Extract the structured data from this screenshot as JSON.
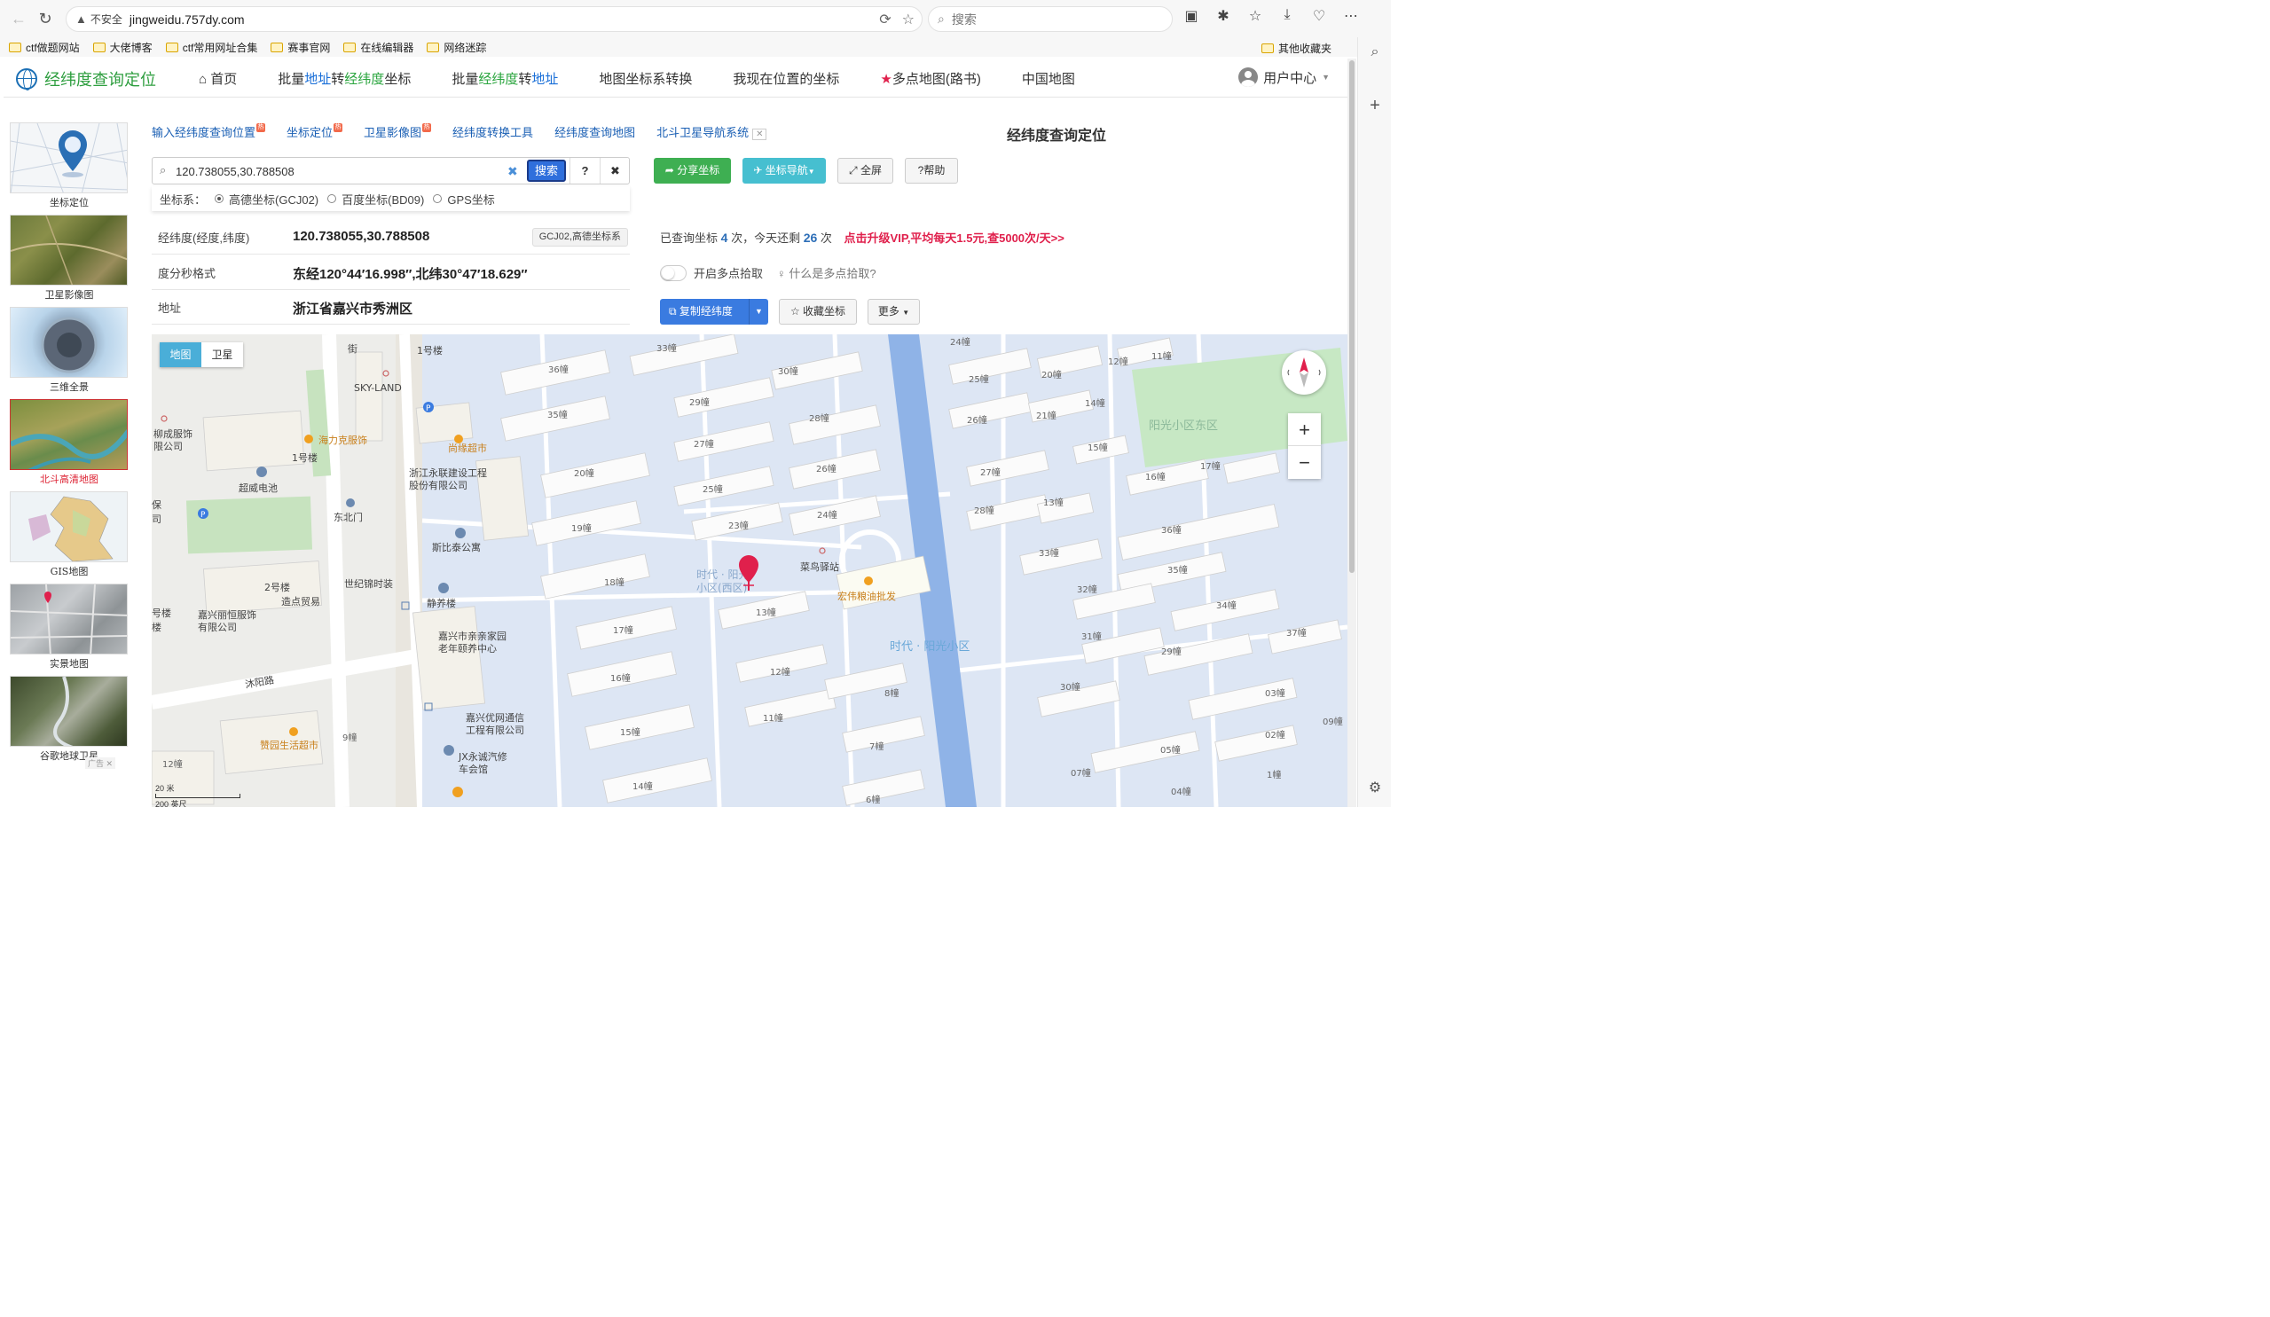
{
  "browser": {
    "insecure_label": "不安全",
    "url": "jingweidu.757dy.com",
    "search_placeholder": "搜索",
    "bookmarks": [
      "ctf做题网站",
      "大佬博客",
      "ctf常用网址合集",
      "赛事官网",
      "在线编辑器",
      "网络迷踪"
    ],
    "other_bookmarks": "其他收藏夹"
  },
  "header": {
    "logo_text": "经纬度查询定位",
    "nav": {
      "home": "首页",
      "batch_a1": "批量",
      "batch_a2": "地址",
      "batch_a3": "转",
      "batch_a4": "经纬度",
      "batch_a5": "坐标",
      "batch_b1": "批量",
      "batch_b2": "经纬度",
      "batch_b3": "转",
      "batch_b4": "地址",
      "convert": "地图坐标系转换",
      "my_location": "我现在位置的坐标",
      "multi_point": "多点地图(路书)",
      "china_map": "中国地图"
    },
    "user_center": "用户中心"
  },
  "sidebar": {
    "items": [
      {
        "caption": "坐标定位"
      },
      {
        "caption": "卫星影像图"
      },
      {
        "caption": "三维全景"
      },
      {
        "caption": "北斗高清地图"
      },
      {
        "caption": "GIS地图"
      },
      {
        "caption": "实景地图"
      },
      {
        "caption": "谷歌地球卫星"
      }
    ],
    "ad_label": "广告"
  },
  "links": [
    "输入经纬度查询位置",
    "坐标定位",
    "卫星影像图",
    "经纬度转换工具",
    "经纬度查询地图",
    "北斗卫星导航系统"
  ],
  "page_title": "经纬度查询定位",
  "search": {
    "value": "120.738055,30.788508",
    "button": "搜索",
    "help": "?",
    "close": "✖"
  },
  "coord_system": {
    "label": "坐标系：",
    "options": [
      "高德坐标(GCJ02)",
      "百度坐标(BD09)",
      "GPS坐标"
    ],
    "selected": 0
  },
  "actions": {
    "share": "分享坐标",
    "navigate": "坐标导航",
    "fullscreen": "全屏",
    "help": "帮助",
    "copy": "复制经纬度",
    "favorite": "收藏坐标",
    "more": "更多"
  },
  "info": {
    "rows": [
      {
        "label": "经纬度(经度,纬度)",
        "value": "120.738055,30.788508",
        "tag": "GCJ02,高德坐标系"
      },
      {
        "label": "度分秒格式",
        "value": "东经120°44′16.998″,北纬30°47′18.629″"
      },
      {
        "label": "地址",
        "value": "浙江省嘉兴市秀洲区"
      }
    ]
  },
  "quota": {
    "prefix": "已查询坐标",
    "queried": "4",
    "mid": "次，今天还剩",
    "remaining": "26",
    "suffix": "次",
    "vip": "点击升级VIP,平均每天1.5元,查5000次/天>>"
  },
  "multi_pick": {
    "label": "开启多点拾取",
    "help": "什么是多点拾取?"
  },
  "map": {
    "tabs": [
      "地图",
      "卫星"
    ],
    "scale_m": "20 米",
    "scale_ft": "200 英尺",
    "labels": {
      "b33": "33幢",
      "b30": "30幢",
      "b36": "36幢",
      "b29": "29幢",
      "b35": "35幢",
      "b28": "28幢",
      "b27": "27幢",
      "b26": "26幢",
      "b20": "20幢",
      "b25": "25幢",
      "b24": "24幢",
      "b19": "19幢",
      "b23": "23幢",
      "b18": "18幢",
      "b17": "17幢",
      "b13": "13幢",
      "b16": "16幢",
      "b12": "12幢",
      "b15": "15幢",
      "b11": "11幢",
      "b14": "14幢",
      "b8": "8幢",
      "b7": "7幢",
      "b6": "6幢",
      "b9": "9幢",
      "b12w": "12幢",
      "e24": "24幢",
      "e25": "25幢",
      "e20": "20幢",
      "e12": "12幢",
      "e11": "11幢",
      "e14": "14幢",
      "e26": "26幢",
      "e21": "21幢",
      "e15": "15幢",
      "e27": "27幢",
      "e16": "16幢",
      "e17": "17幢",
      "e28": "28幢",
      "e13": "13幢",
      "e36": "36幢",
      "e33": "33幢",
      "e35": "35幢",
      "e32": "32幢",
      "e34": "34幢",
      "e31": "31幢",
      "e37": "37幢",
      "e29": "29幢",
      "e30": "30幢",
      "e03": "03幢",
      "e02": "02幢",
      "e09": "09幢",
      "e05": "05幢",
      "e07": "07幢",
      "e1": "1幢",
      "e04": "04幢",
      "bld1": "1号楼",
      "skyland": "SKY-LAND",
      "jie": "街",
      "liucheng": "柳成服饰\n限公司",
      "hailike": "海力克服饰",
      "shangyuan": "尚缘超市",
      "bld1b": "1号楼",
      "yonglian": "浙江永联建设工程\n股份有限公司",
      "chaowei": "超威电池",
      "dongbeimen": "东北门",
      "sibitai": "斯比泰公寓",
      "shiji": "世纪锦时装",
      "bld2": "2号楼",
      "zaodian": "造点贸易",
      "jiaxingli": "嘉兴丽恒服饰\n有限公司",
      "jingyang": "静养楼",
      "qinqin": "嘉兴市亲亲家园\n老年颐养中心",
      "muyang": "沐阳路",
      "youwang": "嘉兴优网通信\n工程有限公司",
      "zanyuan": "赞园生活超市",
      "yongcheng": "JX永诚汽修\n车会馆",
      "shidai_w": "时代 · 阳光\n小区(西区)",
      "cainiao": "菜鸟驿站",
      "hongwei": "宏伟粮油批发",
      "shidai": "时代 · 阳光小区",
      "yangguang_e": "阳光小区东区",
      "louA": "号楼",
      "louB": "楼",
      "bao": "保",
      "si": "司"
    }
  }
}
